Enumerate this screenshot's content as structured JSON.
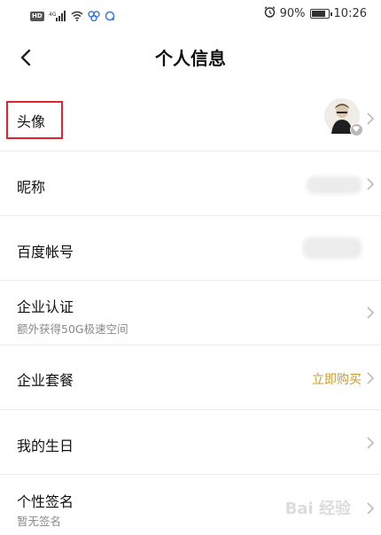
{
  "status_bar": {
    "network_badge": "HD",
    "signal_text": "4G",
    "battery_percent": "90%",
    "battery_level": 0.9,
    "time": "10:26"
  },
  "header": {
    "title": "个人信息"
  },
  "rows": [
    {
      "label": "头像"
    },
    {
      "label": "昵称"
    },
    {
      "label": "百度帐号"
    },
    {
      "label": "企业认证",
      "sub": "额外获得50G极速空间"
    },
    {
      "label": "企业套餐",
      "value": "立即购买"
    },
    {
      "label": "我的生日"
    },
    {
      "label": "个性签名",
      "sub": "暂无签名"
    }
  ],
  "colors": {
    "accent_value": "#c99a2e",
    "highlight_box": "#e0252b",
    "divider": "#ededed"
  },
  "watermark": "Bai 经验"
}
